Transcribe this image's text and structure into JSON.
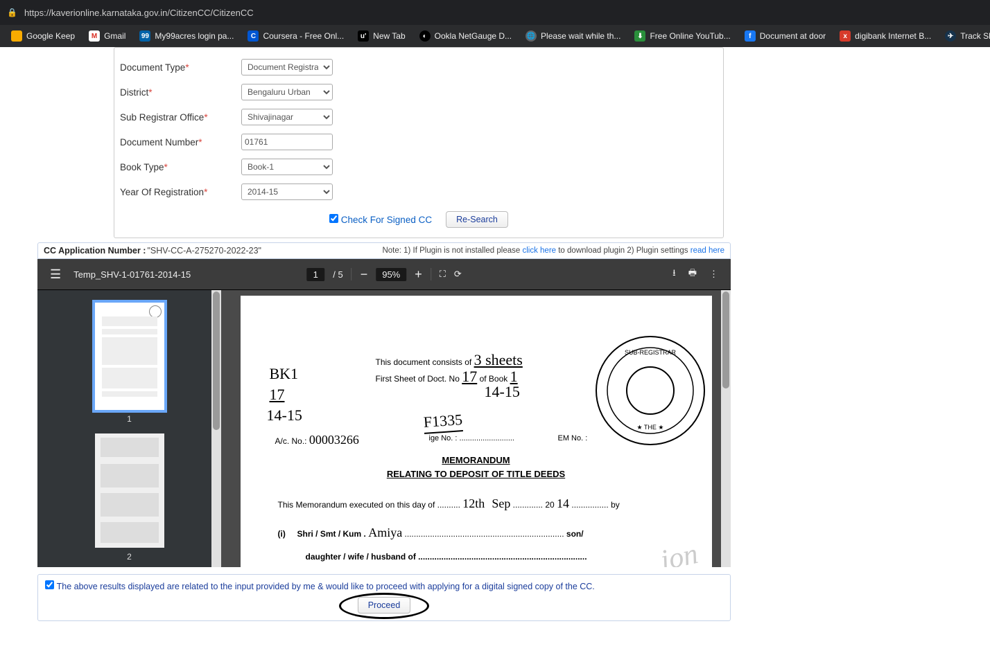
{
  "browser": {
    "url": "https://kaverionline.karnataka.gov.in/CitizenCC/CitizenCC",
    "bookmarks": [
      "Google Keep",
      "Gmail",
      "My99acres login pa...",
      "Coursera - Free Onl...",
      "New Tab",
      "Ookla NetGauge D...",
      "Please wait while th...",
      "Free Online YouTub...",
      "Document at door",
      "digibank Internet B...",
      "Track Shipment Stat..."
    ]
  },
  "form": {
    "fields": {
      "doc_type": {
        "label": "Document Type",
        "value": "Document Registratio"
      },
      "district": {
        "label": "District",
        "value": "Bengaluru Urban"
      },
      "sro": {
        "label": "Sub Registrar Office",
        "value": "Shivajinagar"
      },
      "doc_no": {
        "label": "Document Number",
        "value": "01761"
      },
      "book_type": {
        "label": "Book Type",
        "value": "Book-1"
      },
      "year": {
        "label": "Year Of Registration",
        "value": "2014-15"
      }
    },
    "check_label": "Check For Signed CC",
    "research_btn": "Re-Search"
  },
  "cc_bar": {
    "label": "CC Application Number :",
    "value": "\"SHV-CC-A-275270-2022-23\"",
    "note_1": "Note: 1) If Plugin is not installed please ",
    "link1": "click here",
    "note_2": " to download plugin 2) Plugin settings ",
    "link2": "read here"
  },
  "pdf": {
    "filename": "Temp_SHV-1-01761-2014-15",
    "page_current": "1",
    "page_total": "5",
    "zoom": "95%",
    "thumbs": [
      "1",
      "2"
    ],
    "doc": {
      "line1": "This document consists of",
      "line1_hand": "3 sheets",
      "line2": "First Sheet of Doct. No",
      "line2_h1": "17",
      "line2_t": "of Book",
      "line2_h2": "1",
      "line3_hand": "14-15",
      "bk": "BK1",
      "h17": "17",
      "h1415": "14-15",
      "f1335": "F1335",
      "ac_l": "A/c. No.:",
      "ac_v": "00003266",
      "ige": "ige No. :",
      "em": "EM No. :",
      "title1": "MEMORANDUM",
      "title2": "RELATING TO DEPOSIT OF TITLE DEEDS",
      "m1": "This Memorandum executed on this day of",
      "m1_h1": "12th",
      "m1_h2": "Sep",
      "m1_20": "20",
      "m1_h3": "14",
      "m1_by": "by",
      "m2_i": "(i)",
      "m2_l": "Shri / Smt / Kum .",
      "m2_h": "Amiya",
      "m2_t": "son/",
      "m3": "daughter / wife / husband of"
    }
  },
  "consent": {
    "text": "The above results displayed are related to the input provided by me & would like to proceed with applying for a digital signed copy of the CC.",
    "proceed": "Proceed"
  }
}
